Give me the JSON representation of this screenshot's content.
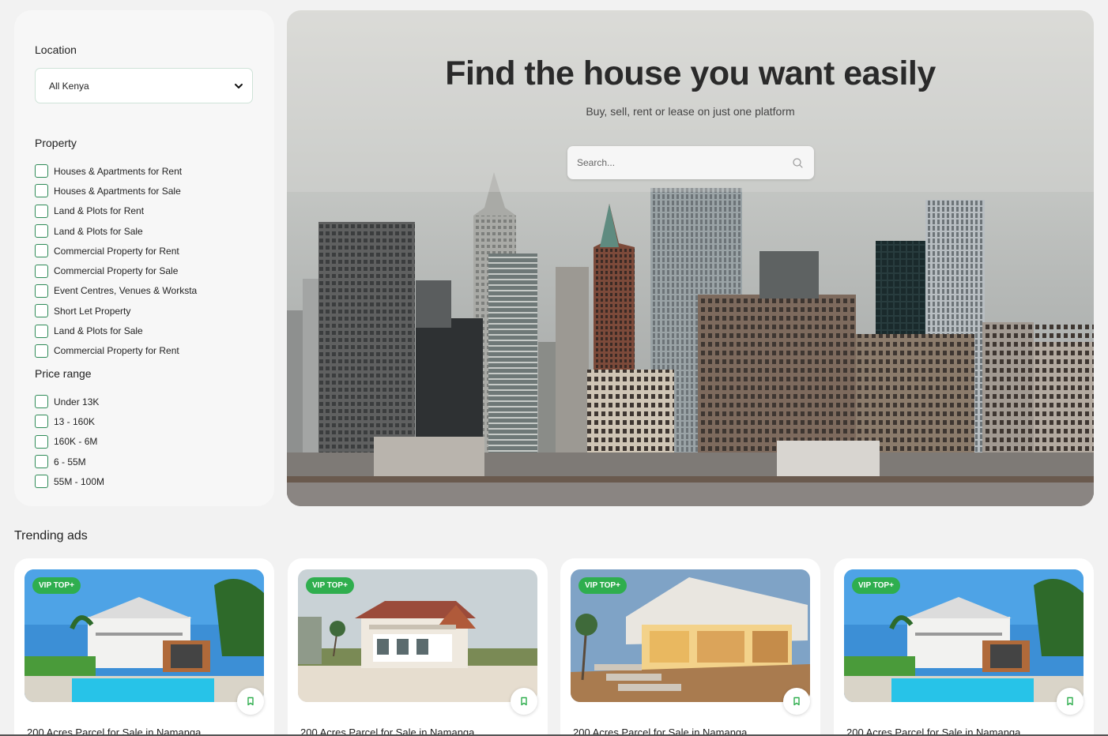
{
  "sidebar": {
    "location_label": "Location",
    "location_value": "All Kenya",
    "property_label": "Property",
    "property_options": [
      "Houses & Apartments for Rent",
      "Houses & Apartments for Sale",
      "Land & Plots for Rent",
      "Land & Plots for Sale",
      "Commercial Property for Rent",
      "Commercial Property for Sale",
      "Event Centres, Venues & Worksta",
      "Short Let Property",
      "Land & Plots for Sale",
      "Commercial Property for Rent"
    ],
    "price_label": "Price range",
    "price_options": [
      "Under 13K",
      "13 - 160K",
      "160K - 6M",
      "6 - 55M",
      "55M - 100M"
    ]
  },
  "hero": {
    "title": "Find the house you want easily",
    "subtitle": "Buy, sell, rent or lease on just one platform",
    "search_placeholder": "Search..."
  },
  "trending": {
    "title": "Trending ads",
    "cards": [
      {
        "badge": "VIP TOP+",
        "title": "200 Acres Parcel for Sale in Namanga",
        "image": "villa-pool"
      },
      {
        "badge": "VIP TOP+",
        "title": "200 Acres Parcel for Sale in Namanga",
        "image": "beach-house"
      },
      {
        "badge": "VIP TOP+",
        "title": "200 Acres Parcel for Sale in Namanga",
        "image": "patio-house"
      },
      {
        "badge": "VIP TOP+",
        "title": "200 Acres Parcel for Sale in Namanga",
        "image": "villa-pool"
      }
    ]
  },
  "colors": {
    "accent_green": "#2fae4e",
    "checkbox_border": "#2e8b57"
  }
}
